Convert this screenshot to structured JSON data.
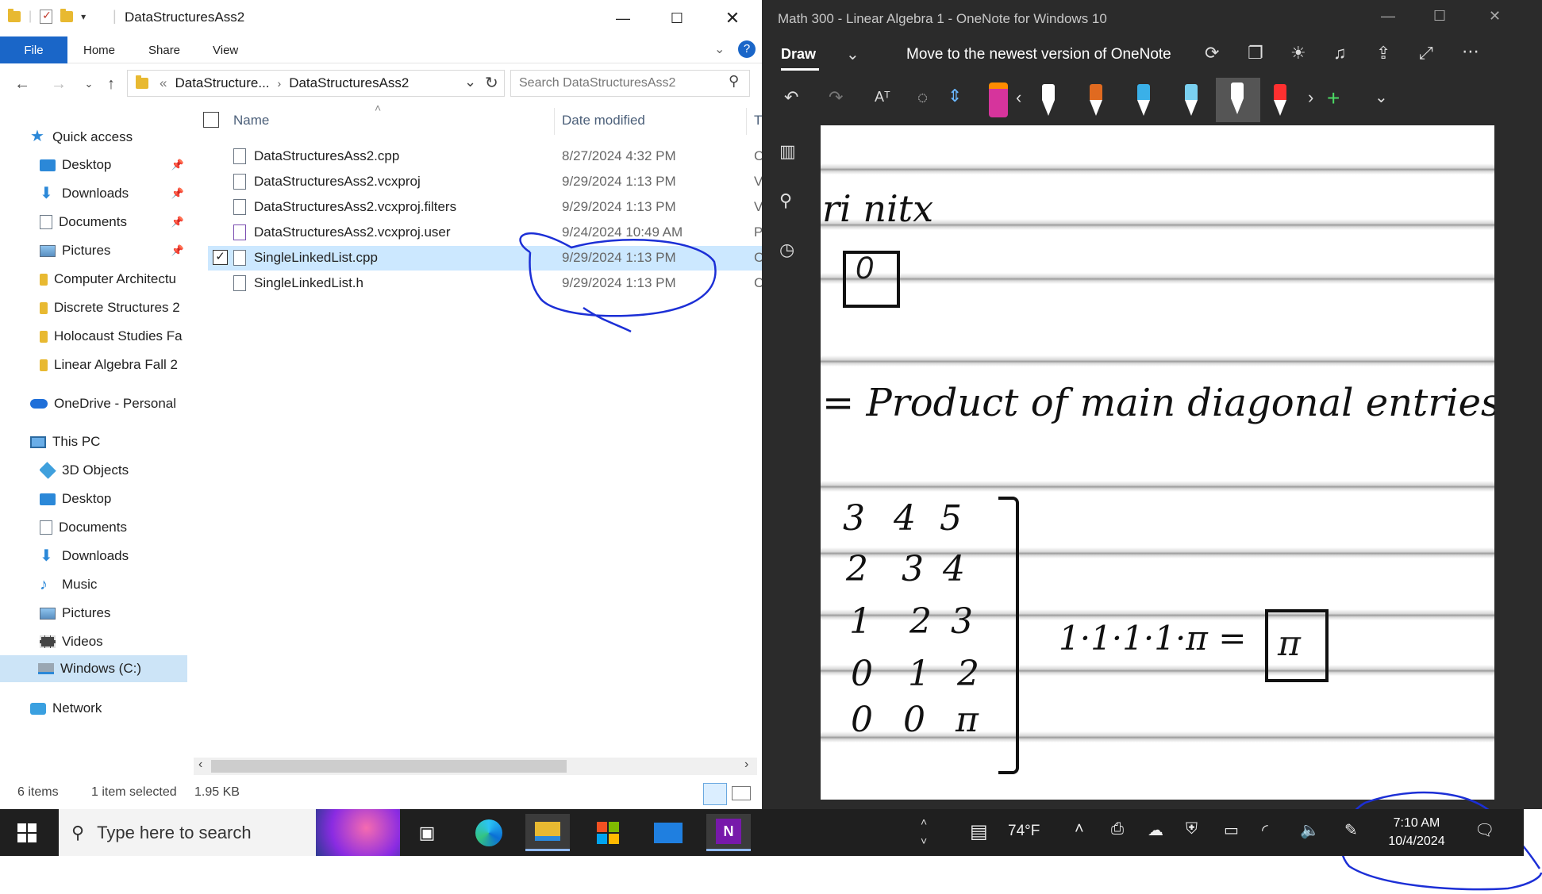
{
  "explorer": {
    "window_title": "DataStructuresAss2",
    "ribbon_tabs": [
      "File",
      "Home",
      "Share",
      "View"
    ],
    "address": {
      "crumb_prefix": "«",
      "crumb1": "DataStructure...",
      "crumb2": "DataStructuresAss2"
    },
    "search_placeholder": "Search DataStructuresAss2",
    "nav": {
      "quick_access": "Quick access",
      "items": [
        {
          "label": "Desktop",
          "icon": "desktop-icon",
          "pinned": true
        },
        {
          "label": "Downloads",
          "icon": "download-arrow-icon",
          "pinned": true
        },
        {
          "label": "Documents",
          "icon": "documents-icon",
          "pinned": true
        },
        {
          "label": "Pictures",
          "icon": "pictures-icon",
          "pinned": true
        },
        {
          "label": "Computer Architectu",
          "icon": "folder-icon"
        },
        {
          "label": "Discrete Structures 2",
          "icon": "folder-icon"
        },
        {
          "label": "Holocaust Studies Fa",
          "icon": "folder-icon"
        },
        {
          "label": "Linear Algebra Fall 2",
          "icon": "folder-icon"
        }
      ],
      "onedrive": "OneDrive - Personal",
      "this_pc": "This PC",
      "pc_items": [
        "3D Objects",
        "Desktop",
        "Documents",
        "Downloads",
        "Music",
        "Pictures",
        "Videos",
        "Windows (C:)"
      ],
      "network": "Network"
    },
    "columns": {
      "name": "Name",
      "date": "Date modified",
      "type": "T"
    },
    "files": [
      {
        "name": "DataStructuresAss2.cpp",
        "date": "8/27/2024 4:32 PM",
        "type": "C"
      },
      {
        "name": "DataStructuresAss2.vcxproj",
        "date": "9/29/2024 1:13 PM",
        "type": "V"
      },
      {
        "name": "DataStructuresAss2.vcxproj.filters",
        "date": "9/29/2024 1:13 PM",
        "type": "V"
      },
      {
        "name": "DataStructuresAss2.vcxproj.user",
        "date": "9/24/2024 10:49 AM",
        "type": "P"
      },
      {
        "name": "SingleLinkedList.cpp",
        "date": "9/29/2024 1:13 PM",
        "type": "C",
        "selected": true
      },
      {
        "name": "SingleLinkedList.h",
        "date": "9/29/2024 1:13 PM",
        "type": "C"
      }
    ],
    "status": {
      "count": "6 items",
      "selection": "1 item selected",
      "size": "1.95 KB"
    }
  },
  "onenote": {
    "window_title": "Math 300 - Linear Algebra 1 - OneNote for Windows 10",
    "draw_tab": "Draw",
    "upgrade_link": "Move to the newest version of OneNote",
    "pen_colors": [
      "#ff8c00",
      "#ffffff",
      "#e06a20",
      "#3ab0e8",
      "#7ad0f0",
      "#ffffff",
      "#ff3030"
    ],
    "handwriting": {
      "line1": "ri nitx",
      "line2": "= Product of main diagonal entries",
      "matrix_rows": [
        [
          "3",
          "4",
          "5"
        ],
        [
          "2",
          "3",
          "4"
        ],
        [
          "1",
          "2",
          "3"
        ],
        [
          "0",
          "1",
          "2"
        ],
        [
          "0",
          "0",
          "π"
        ]
      ],
      "equation": "1·1·1·1·π =",
      "boxed_answer": "π",
      "boxed_zero": "0"
    }
  },
  "taskbar": {
    "search_placeholder": "Type here to search",
    "weather": "74°F",
    "time": "7:10 AM",
    "date": "10/4/2024"
  },
  "colors": {
    "accent": "#1a66c8",
    "annotation": "#1c2fd6",
    "selection": "#cce8ff"
  }
}
